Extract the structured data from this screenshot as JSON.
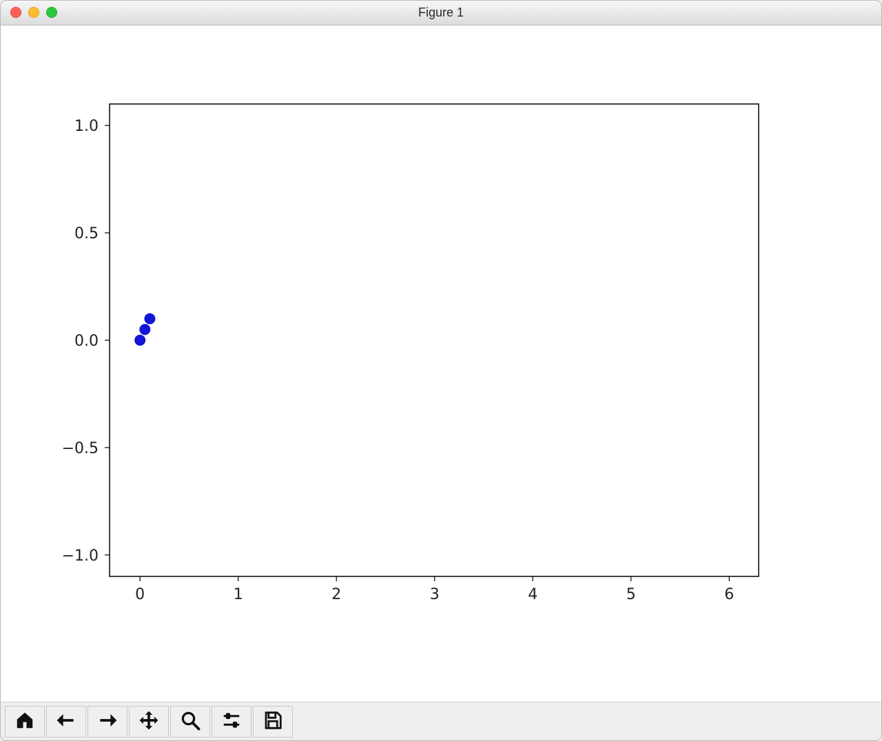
{
  "window": {
    "title": "Figure 1"
  },
  "traffic": {
    "close_color": "#ff5f57",
    "min_color": "#ffbd2e",
    "zoom_color": "#28c840"
  },
  "chart_data": {
    "type": "scatter",
    "series": [
      {
        "name": "s1",
        "x": [
          0.0,
          0.05,
          0.1
        ],
        "y": [
          0.0,
          0.05,
          0.1
        ],
        "color": "#1216d6"
      }
    ],
    "xlabel": "",
    "ylabel": "",
    "xlim": [
      -0.31,
      6.3
    ],
    "ylim": [
      -1.1,
      1.1
    ],
    "xticks": [
      0,
      1,
      2,
      3,
      4,
      5,
      6
    ],
    "yticks": [
      -1.0,
      -0.5,
      0.0,
      0.5,
      1.0
    ],
    "title": ""
  },
  "toolbar": {
    "buttons": [
      "home",
      "back",
      "forward",
      "pan",
      "zoom",
      "configure",
      "save"
    ]
  }
}
